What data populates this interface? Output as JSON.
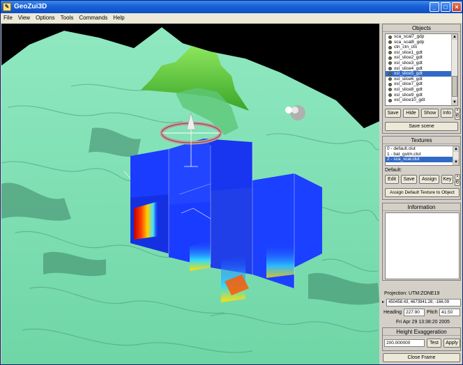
{
  "window": {
    "title": "GeoZui3D",
    "app_icon": "pencil-icon"
  },
  "menubar": [
    "File",
    "View",
    "Options",
    "Tools",
    "Commands",
    "Help"
  ],
  "objects_panel": {
    "header": "Objects",
    "items": [
      {
        "label": "sca_scal7_gdp",
        "selected": false
      },
      {
        "label": "sca_scal8_gdp",
        "selected": false
      },
      {
        "label": "ctn_ctn_ctn",
        "selected": false
      },
      {
        "label": "xsl_slice1_gdt",
        "selected": false
      },
      {
        "label": "xsl_slice2_gdt",
        "selected": false
      },
      {
        "label": "xsl_slice3_gdt",
        "selected": false
      },
      {
        "label": "xsl_slice4_gdt",
        "selected": false
      },
      {
        "label": "xsl_slice5_gdt",
        "selected": true
      },
      {
        "label": "xsl_slice6_gdt",
        "selected": false
      },
      {
        "label": "xsl_slice7_gdt",
        "selected": false
      },
      {
        "label": "xsl_slice8_gdt",
        "selected": false
      },
      {
        "label": "xsl_slice9_gdt",
        "selected": false
      },
      {
        "label": "xsl_slice10_gdt",
        "selected": false
      }
    ],
    "buttons": {
      "save": "Save",
      "hide": "Hide",
      "show": "Show",
      "info": "Info"
    },
    "save_scene": "Save scene"
  },
  "textures_panel": {
    "header": "Textures",
    "items": [
      {
        "label": "0 - default.clut",
        "selected": false
      },
      {
        "label": "1 - bat_gutm.clut",
        "selected": false
      },
      {
        "label": "2 - sca_scal.clut",
        "selected": true
      }
    ],
    "default_label": "Default:",
    "buttons": {
      "edit": "Edit",
      "save": "Save",
      "assign": "Assign",
      "key": "Key"
    },
    "assign_default": "Assign Default Texture to Object"
  },
  "information_panel": {
    "header": "Information"
  },
  "projection": {
    "label": "Projection:",
    "value": "UTM:ZONE19",
    "coords": "450458.43, 4673941.28, -166.09",
    "heading_label": "Heading",
    "heading_value": "227.90",
    "pitch_label": "Pitch",
    "pitch_value": "41.50",
    "timestamp": "Fri Apr 29 13:38:20 2005"
  },
  "height_exaggeration": {
    "header": "Height Exaggeration",
    "value": "200.000000",
    "test": "Test",
    "apply": "Apply"
  },
  "close_frame": "Close Frame",
  "colors": {
    "terrain": "#7de0b0",
    "terrain_shadow": "#3a8a68",
    "ridge": "#55c93a",
    "slice_blue": "#1a3cff",
    "selection": "#316ac5"
  }
}
